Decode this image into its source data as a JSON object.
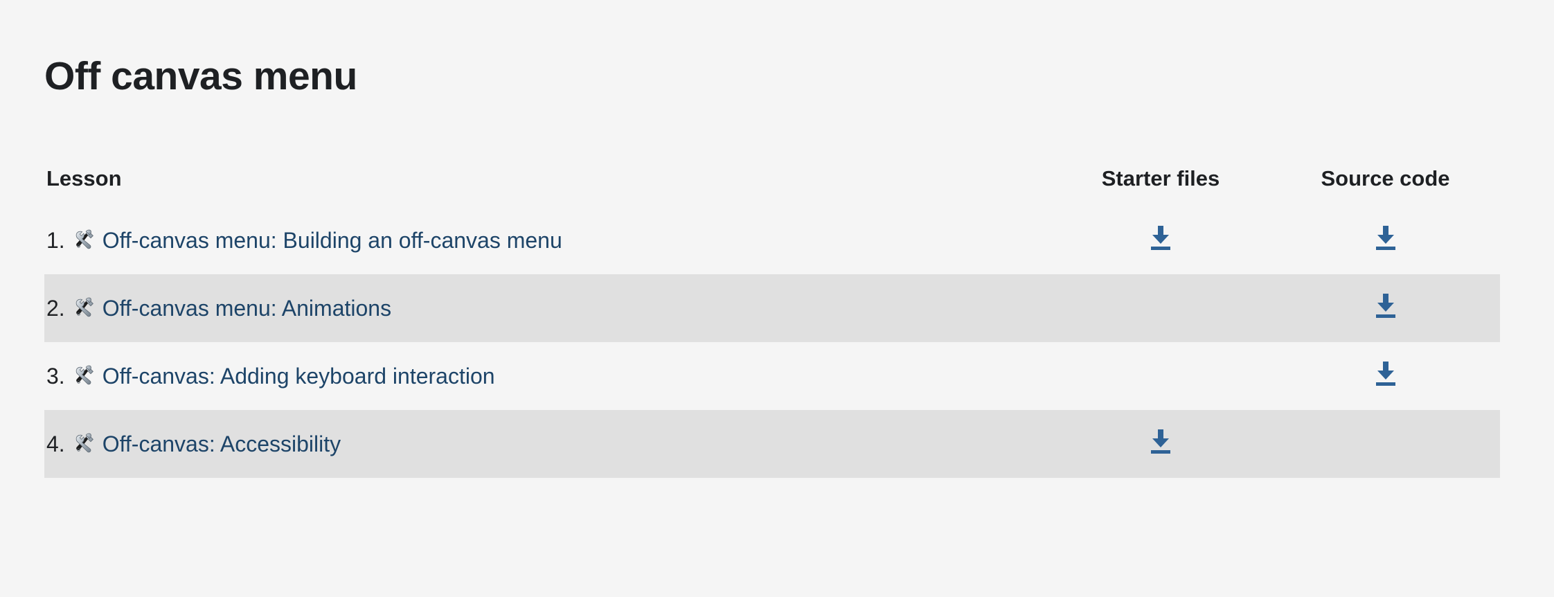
{
  "page": {
    "title": "Off canvas menu",
    "background_color": "#f5f5f5",
    "stripe_color": "#e0e0e0",
    "title_color": "#1e2023",
    "link_color": "#1d4468",
    "icon_color": "#2e6296"
  },
  "table": {
    "headers": {
      "lesson": "Lesson",
      "starter_files": "Starter files",
      "source_code": "Source code"
    },
    "rows": [
      {
        "number": "1.",
        "emoji_name": "hammer-and-wrench-emoji",
        "title": "Off-canvas menu: Building an off-canvas menu",
        "starter_files": true,
        "source_code": true,
        "striped": false
      },
      {
        "number": "2.",
        "emoji_name": "hammer-and-wrench-emoji",
        "title": "Off-canvas menu: Animations",
        "starter_files": false,
        "source_code": true,
        "striped": true
      },
      {
        "number": "3.",
        "emoji_name": "hammer-and-wrench-emoji",
        "title": "Off-canvas: Adding keyboard interaction",
        "starter_files": false,
        "source_code": true,
        "striped": false
      },
      {
        "number": "4.",
        "emoji_name": "hammer-and-wrench-emoji",
        "title": "Off-canvas: Accessibility",
        "starter_files": true,
        "source_code": false,
        "striped": true
      }
    ]
  }
}
